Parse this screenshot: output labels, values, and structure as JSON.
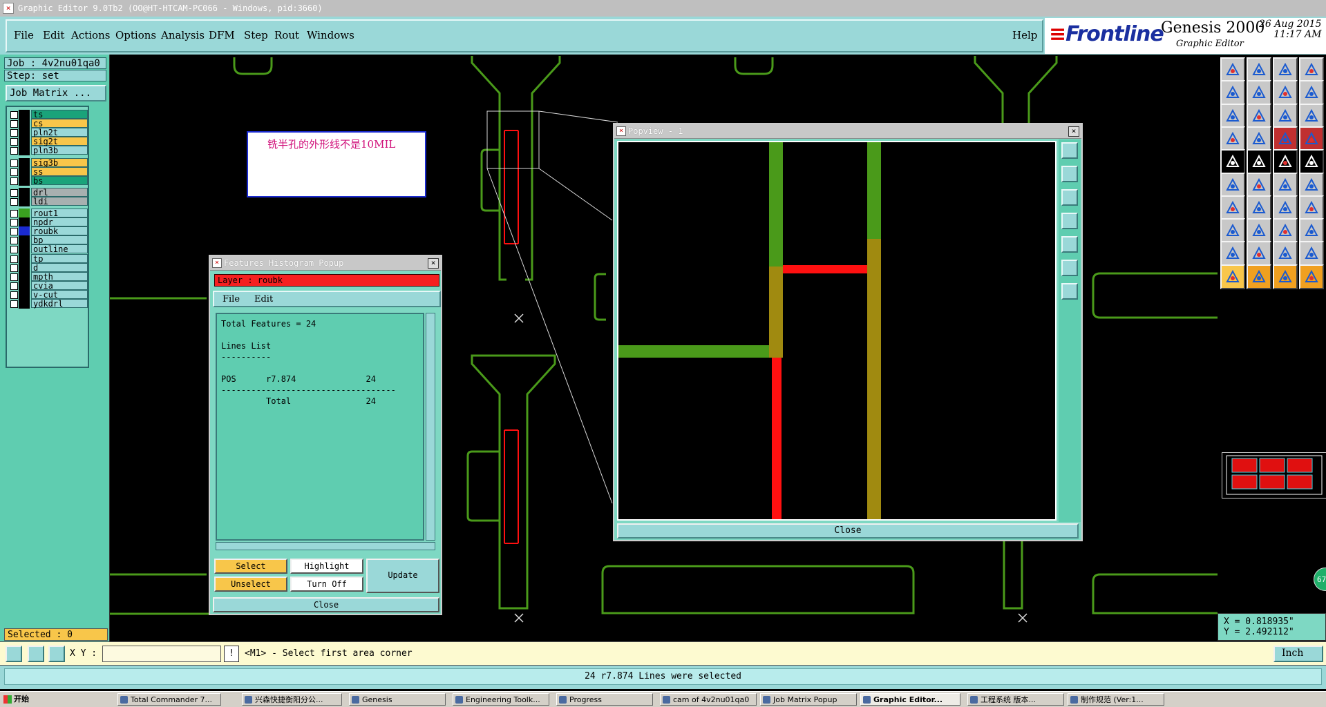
{
  "window": {
    "title": "Graphic Editor 9.0Tb2 (OO@HT-HTCAM-PC066 - Windows, pid:3660)"
  },
  "menu": {
    "items": [
      "File",
      "Edit",
      "Actions",
      "Options",
      "Analysis",
      "DFM",
      "Step",
      "Rout",
      "Windows"
    ],
    "help": "Help"
  },
  "brand": {
    "logo": "Frontline",
    "product": "Genesis 2000",
    "subtitle": "Graphic Editor",
    "date": "26 Aug 2015",
    "time": "11:17 AM"
  },
  "left_panel": {
    "job": "Job : 4v2nu01qa0",
    "step": "Step: set",
    "job_matrix_button": "Job Matrix ...",
    "selected": "Selected : 0",
    "layers": [
      {
        "name": "ts",
        "bg": "#1aa37a",
        "color": "#000000"
      },
      {
        "name": "cs",
        "bg": "#f8c64a",
        "color": "#000000"
      },
      {
        "name": "pln2t",
        "bg": "#9ad8d8",
        "color": "#000000"
      },
      {
        "name": "sig2t",
        "bg": "#f8c64a",
        "color": "#000000"
      },
      {
        "name": "pln3b",
        "bg": "#9ad8d8",
        "color": "#000000"
      },
      {
        "name": "sig3b",
        "bg": "#f8c64a",
        "color": "#000000"
      },
      {
        "name": "ss",
        "bg": "#f8c64a",
        "color": "#000000"
      },
      {
        "name": "bs",
        "bg": "#1aa37a",
        "color": "#000000"
      },
      {
        "name": "drl",
        "bg": "#a8b0b0",
        "color": "#000000"
      },
      {
        "name": "ldi",
        "bg": "#a8b0b0",
        "color": "#000000"
      },
      {
        "name": "rout1",
        "bg": "#9ad8d8",
        "color": "#3aa020"
      },
      {
        "name": "npdr",
        "bg": "#9ad8d8",
        "color": "#000000"
      },
      {
        "name": "roubk",
        "bg": "#9ad8d8",
        "color": "#1a2ad0"
      },
      {
        "name": "bp",
        "bg": "#9ad8d8",
        "color": "#000000"
      },
      {
        "name": "outline",
        "bg": "#9ad8d8",
        "color": "#000000"
      },
      {
        "name": "tp",
        "bg": "#9ad8d8",
        "color": "#000000"
      },
      {
        "name": "d",
        "bg": "#9ad8d8",
        "color": "#000000"
      },
      {
        "name": "mpth",
        "bg": "#9ad8d8",
        "color": "#000000"
      },
      {
        "name": "cvia",
        "bg": "#9ad8d8",
        "color": "#000000"
      },
      {
        "name": "v-cut",
        "bg": "#9ad8d8",
        "color": "#000000"
      },
      {
        "name": "ydkdrl",
        "bg": "#9ad8d8",
        "color": "#000000"
      }
    ]
  },
  "note": {
    "text": "铣半孔的外形线不是10MIL"
  },
  "histogram": {
    "title": "Features Histogram Popup",
    "layer": "Layer :  roubk",
    "menu_file": "File",
    "menu_edit": "Edit",
    "content": "Total Features = 24\n\nLines List\n----------\n\nPOS      r7.874              24\n-----------------------------------\n         Total               24",
    "buttons": {
      "select": "Select",
      "highlight": "Highlight",
      "update": "Update",
      "unselect": "Unselect",
      "turn_off": "Turn Off",
      "close": "Close"
    }
  },
  "popview": {
    "title": "Popview - 1",
    "close": "Close"
  },
  "coords": {
    "x": "X = 0.818935\"",
    "y": "Y = 2.492112\""
  },
  "xybar": {
    "label": "X Y :",
    "input_value": "",
    "bang": "!",
    "prompt": "<M1> - Select first area corner",
    "unit": "Inch"
  },
  "status": {
    "message": "24 r7.874 Lines were selected"
  },
  "taskbar": {
    "start": "开始",
    "tasks": [
      "Total Commander 7...",
      "兴森快捷衡阳分公...",
      "Genesis",
      "Engineering Toolk...",
      "Progress",
      "cam of 4v2nu01qa0",
      "Job Matrix Popup",
      "Graphic Editor...",
      "工程系统   版本...",
      "制作规范 (Ver:1..."
    ]
  },
  "badge": "67",
  "colors": {
    "panel": "#5fcdb0",
    "menubar": "#9ad8d8",
    "rout_green": "#4a9a1a",
    "select_red": "#ff1010",
    "accent_yellow": "#f8c64a"
  }
}
